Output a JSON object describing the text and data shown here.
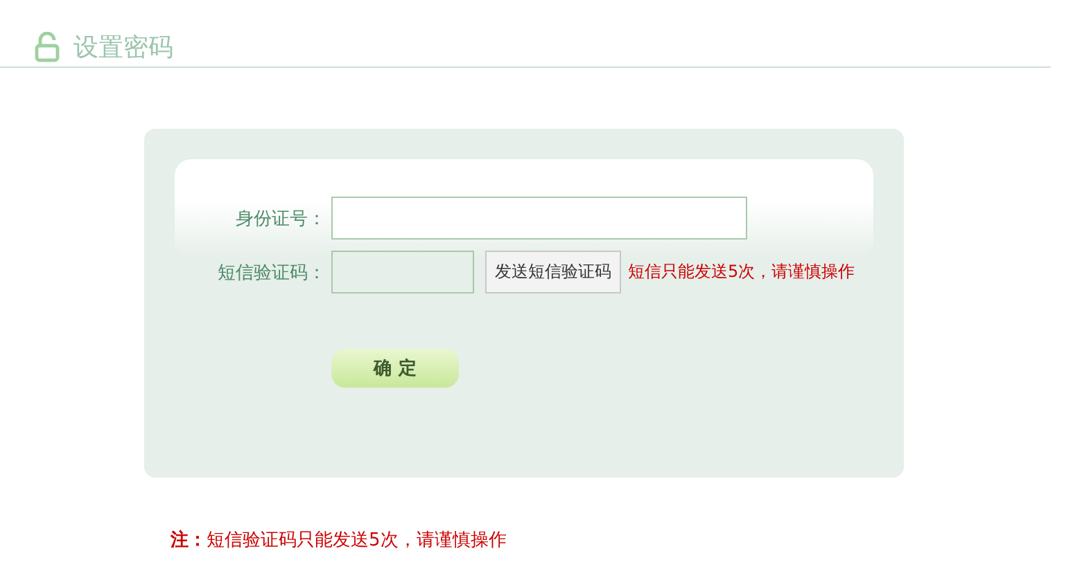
{
  "header": {
    "title": "设置密码"
  },
  "form": {
    "fields": [
      {
        "label": "身份证号：",
        "kind": "text",
        "disabled": false
      },
      {
        "label": "短信验证码：",
        "kind": "code",
        "disabled": true,
        "button": "发送短信验证码",
        "hint": "短信只能发送5次，请谨慎操作"
      }
    ],
    "submit": "确 定"
  },
  "note": "**注：**短信验证码只能发送5次，请谨慎操作"
}
